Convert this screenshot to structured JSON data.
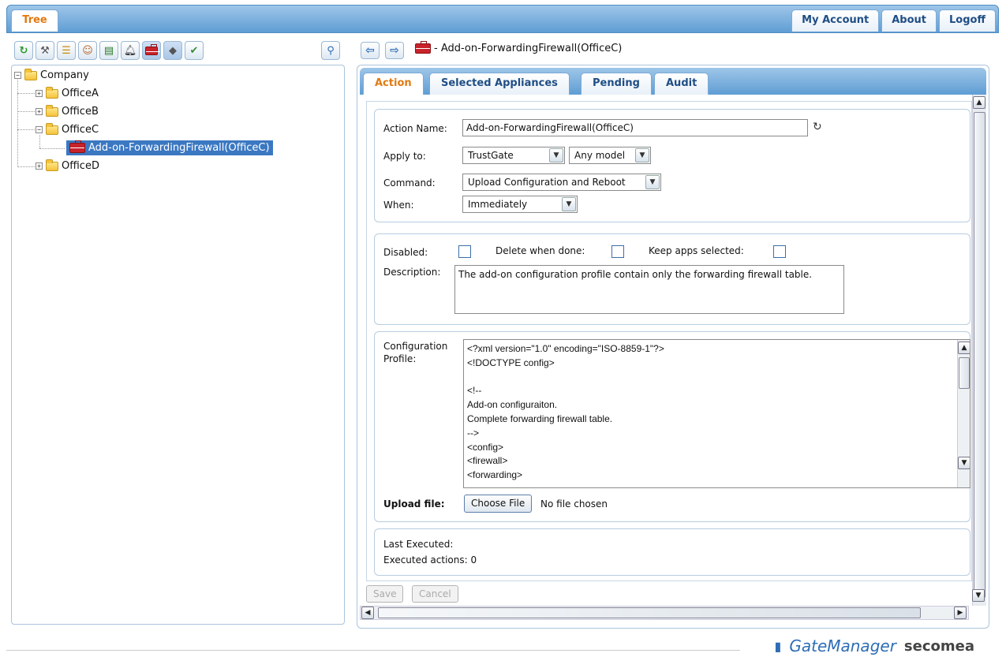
{
  "top_tabs": {
    "tree": "Tree",
    "my_account": "My Account",
    "about": "About",
    "logoff": "Logoff"
  },
  "toolbar_icons": [
    "refresh-icon",
    "hammer-icon",
    "tree-icon",
    "user-icon",
    "certificate-icon",
    "bell-icon",
    "briefcase-icon",
    "appliance-icon",
    "appliance-check-icon"
  ],
  "tree": {
    "root": "Company",
    "nodes": [
      "OfficeA",
      "OfficeB",
      "OfficeC",
      "Add-on-ForwardingFirewall(OfficeC)",
      "OfficeD"
    ],
    "expander_collapsed": "+",
    "expander_expanded": "−"
  },
  "header": {
    "back": "⇦",
    "forward": "⇨",
    "title": "- Add-on-ForwardingFirewall(OfficeC)"
  },
  "tabs": {
    "action": "Action",
    "selected_appliances": "Selected Appliances",
    "pending": "Pending",
    "audit": "Audit"
  },
  "form": {
    "action_name_label": "Action Name:",
    "action_name_value": "Add-on-ForwardingFirewall(OfficeC)",
    "apply_to_label": "Apply to:",
    "apply_to_value": "TrustGate",
    "model_value": "Any model",
    "command_label": "Command:",
    "command_value": "Upload Configuration and Reboot",
    "when_label": "When:",
    "when_value": "Immediately",
    "disabled_label": "Disabled:",
    "delete_label": "Delete when done:",
    "keep_label": "Keep apps selected:",
    "description_label": "Description:",
    "description_value": "The add-on configuration profile contain only the forwarding firewall table.",
    "config_label_1": "Configuration",
    "config_label_2": "Profile:",
    "config_lines": [
      "<?xml version=\"1.0\" encoding=\"ISO-8859-1\"?>",
      "<!DOCTYPE config>",
      "",
      "<!--",
      "Add-on configuraiton.",
      "Complete forwarding firewall table.",
      "-->",
      "<config>",
      "<firewall>",
      "<forwarding>"
    ],
    "upload_label": "Upload file:",
    "choose_file": "Choose File",
    "no_file": "No file chosen",
    "last_executed_label": "Last Executed:",
    "executed_actions_label": "Executed actions: 0"
  },
  "buttons": {
    "save": "Save",
    "cancel": "Cancel"
  },
  "brand": {
    "gatemanager": "GateManager",
    "secomea": "secomea"
  },
  "colors": {
    "accent_orange": "#e07a10",
    "tab_blue": "#1f4e85",
    "selection": "#3b78c2"
  }
}
